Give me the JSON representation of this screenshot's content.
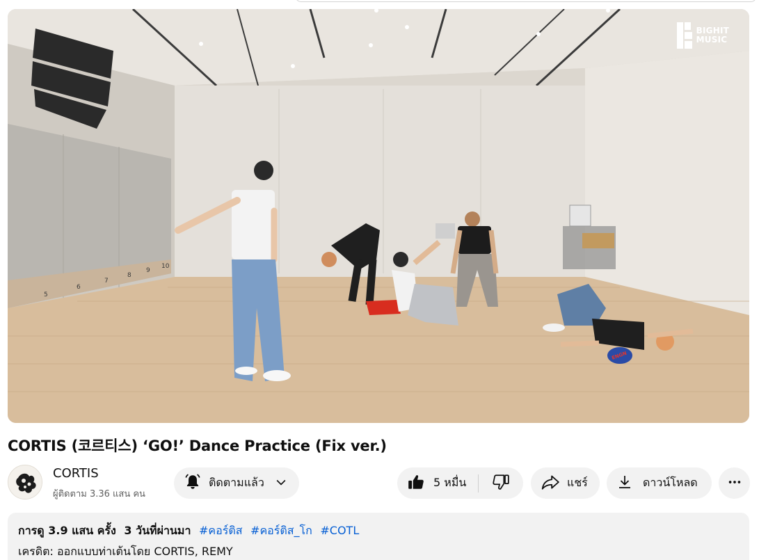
{
  "video": {
    "watermark_line1": "BIGHIT",
    "watermark_line2": "MUSIC",
    "mirror_numbers": [
      "5",
      "6",
      "7",
      "8",
      "9",
      "10"
    ],
    "cap_text": "ENGN"
  },
  "title": "CORTIS (코르티스) ‘GO!’ Dance Practice (Fix ver.)",
  "channel": {
    "name": "CORTIS",
    "subscribers": "ผู้ติดตาม 3.36 แสน คน"
  },
  "actions": {
    "subscribed_label": "ติดตามแล้ว",
    "like_count": "5 หมื่น",
    "share_label": "แชร์",
    "download_label": "ดาวน์โหลด"
  },
  "description": {
    "views": "การดู 3.9 แสน ครั้ง",
    "date": "3 วันที่ผ่านมา",
    "hashtags": [
      "#คอร์ติส",
      "#คอร์ติส_โก",
      "#COTL"
    ],
    "credit": "เครดิต: ออกแบบท่าเต้นโดย CORTIS, REMY"
  },
  "colors": {
    "hashtag": "#065fd4",
    "pill_bg": "#f2f2f2",
    "secondary_text": "#606060"
  },
  "icons": {
    "bell": "bell-icon",
    "chevron": "chevron-down-icon",
    "like": "thumbs-up-icon",
    "dislike": "thumbs-down-icon",
    "share": "share-icon",
    "download": "download-icon",
    "more": "more-horizontal-icon"
  }
}
